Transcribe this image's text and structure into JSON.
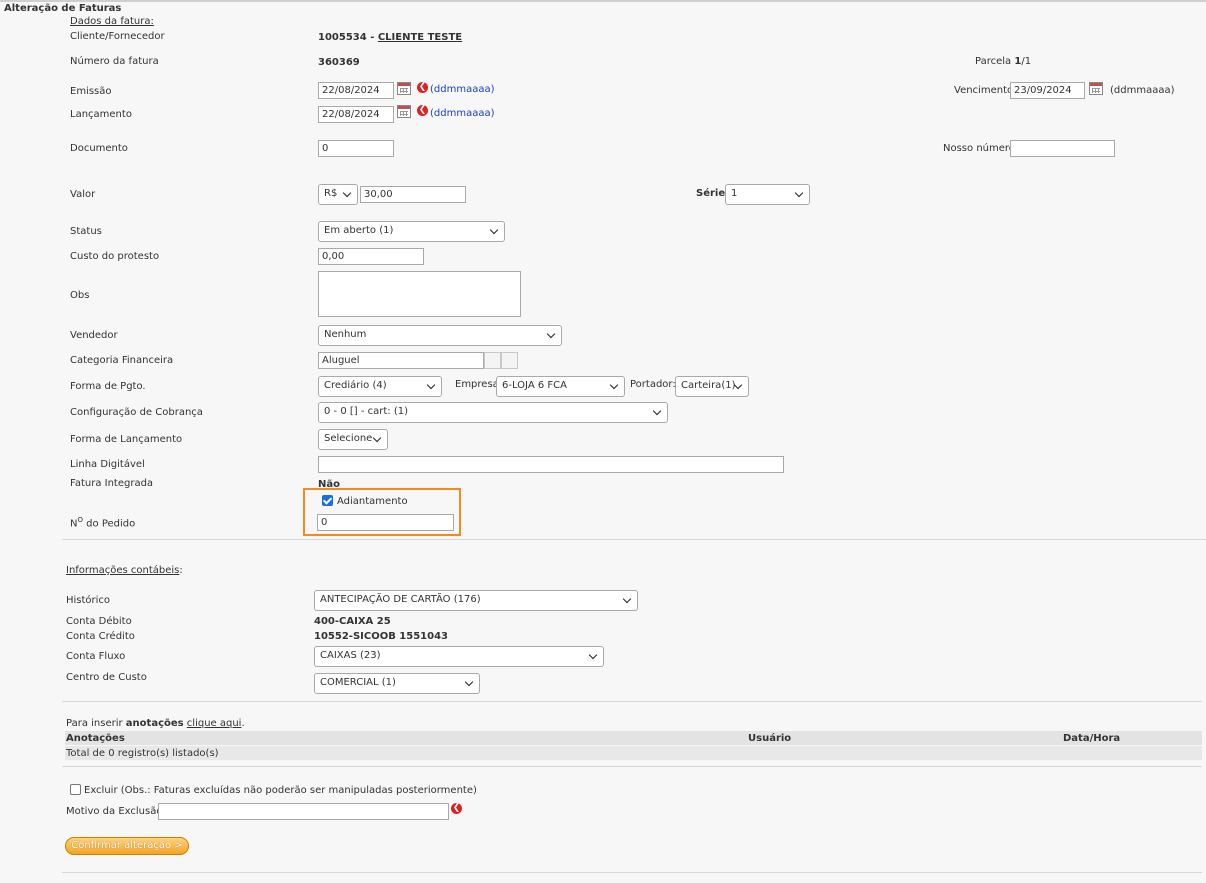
{
  "page": {
    "title": "Alteração de Faturas"
  },
  "invoice": {
    "section_label": "Dados da fatura:",
    "cliente_label": "Cliente/Fornecedor",
    "cliente_code": "1005534",
    "cliente_sep": " - ",
    "cliente_name": "CLIENTE TESTE",
    "numero_label": "Número da fatura",
    "numero_value": "360369",
    "parcela_label": "Parcela",
    "parcela_value": "1",
    "parcela_total": "/1",
    "emissao_label": "Emissão",
    "emissao_value": "22/08/2024",
    "lancamento_label": "Lançamento",
    "lancamento_value": "22/08/2024",
    "date_format": "(ddmmaaaa)",
    "vencimento_label": "Vencimento",
    "vencimento_value": "23/09/2024",
    "vencimento_format": "(ddmmaaaa)",
    "documento_label": "Documento",
    "documento_value": "0",
    "nosso_numero_label": "Nosso número",
    "nosso_numero_value": "",
    "valor_label": "Valor",
    "currency": "R$",
    "valor_value": "30,00",
    "serie_label": "Série",
    "serie_value": "1",
    "status_label": "Status",
    "status_value": "Em aberto (1)",
    "custo_protesto_label": "Custo do protesto",
    "custo_protesto_value": "0,00",
    "obs_label": "Obs",
    "obs_value": "",
    "vendedor_label": "Vendedor",
    "vendedor_value": "Nenhum",
    "categoria_label": "Categoria Financeira",
    "categoria_value": "Aluguel",
    "forma_pgto_label": "Forma de Pgto.",
    "forma_pgto_value": "Crediário (4)",
    "empresa_label": "Empresa",
    "empresa_value": "6-LOJA 6 FCA",
    "portador_label": "Portador:",
    "portador_value": "Carteira(1)",
    "config_cobranca_label": "Configuração de Cobrança",
    "config_cobranca_value": "0 - 0 [] - cart: (1)",
    "forma_lancamento_label": "Forma de Lançamento",
    "forma_lancamento_value": "Selecione",
    "linha_digitavel_label": "Linha Digitável",
    "linha_digitavel_value": "",
    "fatura_integrada_label": "Fatura Integrada",
    "fatura_integrada_value": "Não",
    "adiantamento_label": "Adiantamento",
    "adiantamento_checked": true,
    "pedido_label_prefix": "N",
    "pedido_label_sup": "O",
    "pedido_label_suffix": " do Pedido",
    "pedido_value": "0"
  },
  "accounting": {
    "section_label": "Informações contábeis",
    "section_colon": ":",
    "historico_label": "Histórico",
    "historico_value": "ANTECIPAÇÃO DE CARTÃO (176)",
    "conta_debito_label": "Conta Débito",
    "conta_debito_value": "400-CAIXA 25",
    "conta_credito_label": "Conta Crédito",
    "conta_credito_value": "10552-SICOOB 1551043",
    "conta_fluxo_label": "Conta Fluxo",
    "conta_fluxo_value": "CAIXAS (23)",
    "centro_custo_label": "Centro de Custo",
    "centro_custo_value": "COMERCIAL (1)"
  },
  "notes": {
    "intro_prefix": "Para inserir ",
    "intro_bold": "anotações",
    "intro_link": "clique aqui",
    "intro_suffix": ".",
    "columns": [
      "Anotações",
      "Usuário",
      "Data/Hora"
    ],
    "total_text": "Total de 0 registro(s) listado(s)"
  },
  "delete": {
    "excluir_label": "Excluir (Obs.: Faturas excluídas não poderão ser manipuladas posteriormente)",
    "excluir_checked": false,
    "motivo_label": "Motivo da Exclusão:",
    "motivo_value": ""
  },
  "actions": {
    "confirm_label": "Confirmar alteração >"
  },
  "colors": {
    "highlight_border": "#f08a24",
    "button_bg": "#f3a426",
    "clear_icon": "#e02020",
    "format_hint": "#1a3fd1"
  }
}
